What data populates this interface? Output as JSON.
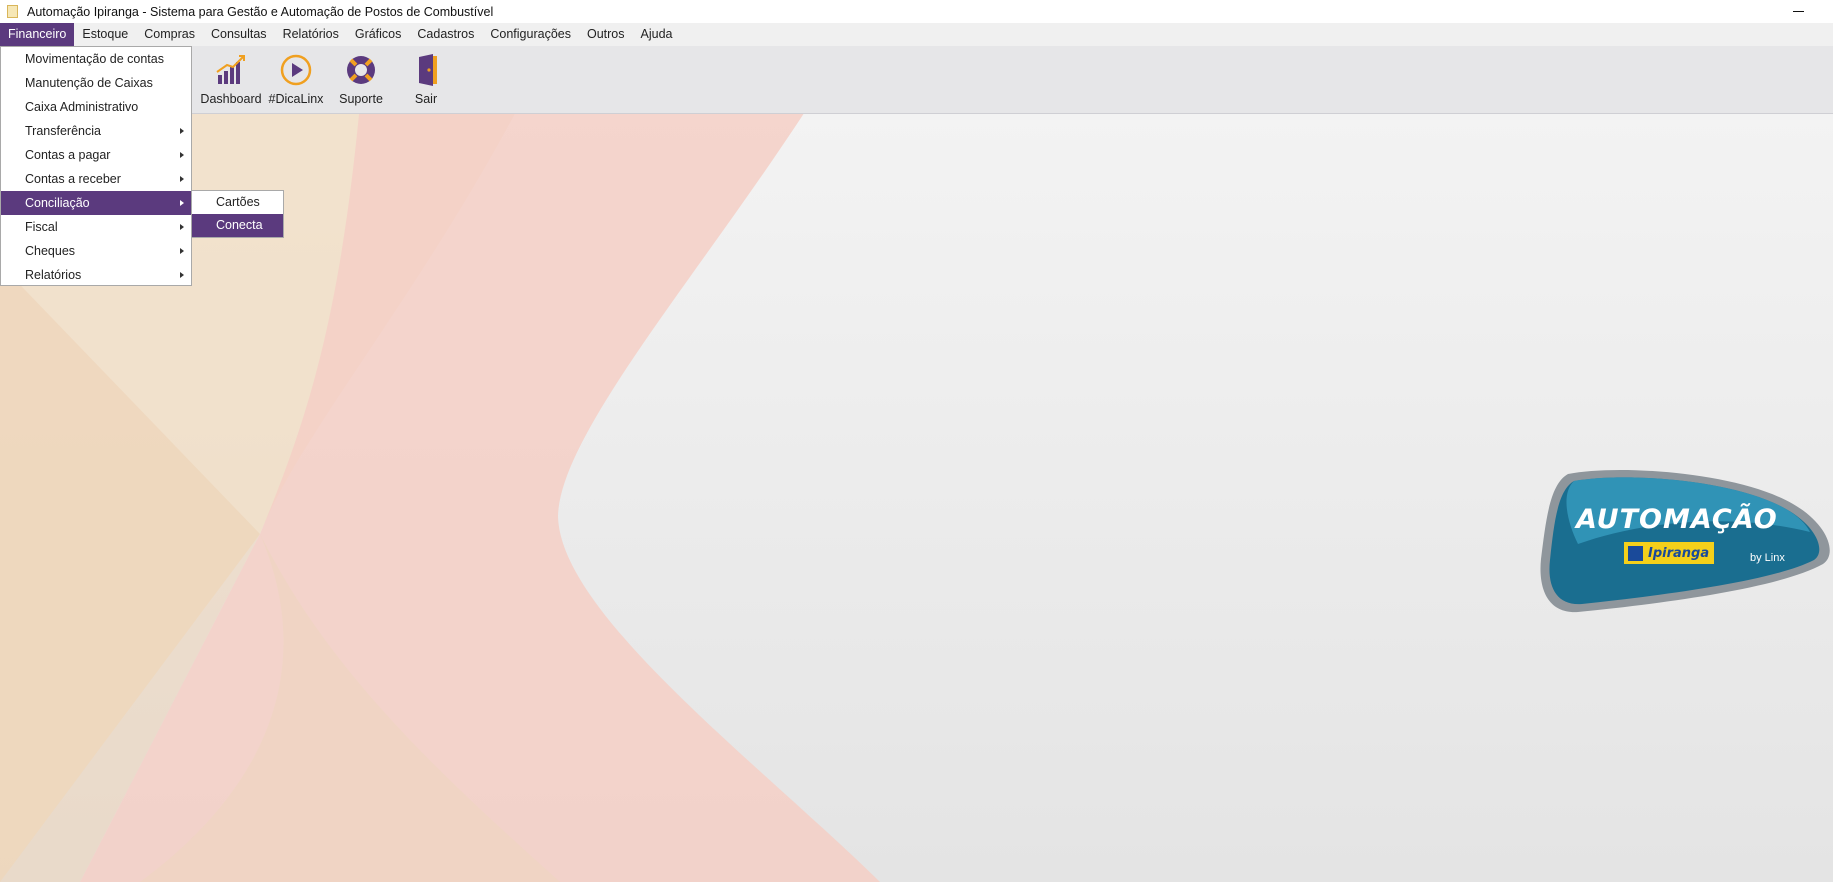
{
  "window": {
    "title": "Automação Ipiranga - Sistema para Gestão e Automação de Postos de Combustível"
  },
  "menubar": {
    "items": [
      {
        "label": "Financeiro",
        "active": true
      },
      {
        "label": "Estoque"
      },
      {
        "label": "Compras"
      },
      {
        "label": "Consultas"
      },
      {
        "label": "Relatórios"
      },
      {
        "label": "Gráficos"
      },
      {
        "label": "Cadastros"
      },
      {
        "label": "Configurações"
      },
      {
        "label": "Outros"
      },
      {
        "label": "Ajuda"
      }
    ]
  },
  "toolbar": {
    "buttons": [
      {
        "label": "Dashboard",
        "icon": "dashboard-chart-icon"
      },
      {
        "label": "#DicaLinx",
        "icon": "play-circle-icon"
      },
      {
        "label": "Suporte",
        "icon": "lifebuoy-icon"
      },
      {
        "label": "Sair",
        "icon": "exit-door-icon"
      }
    ]
  },
  "financeiro_menu": {
    "items": [
      {
        "label": "Movimentação de contas",
        "submenu": false
      },
      {
        "label": "Manutenção de Caixas",
        "submenu": false
      },
      {
        "label": "Caixa Administrativo",
        "submenu": false
      },
      {
        "label": "Transferência",
        "submenu": true
      },
      {
        "label": "Contas a pagar",
        "submenu": true
      },
      {
        "label": "Contas a receber",
        "submenu": true
      },
      {
        "label": "Conciliação",
        "submenu": true,
        "active": true
      },
      {
        "label": "Fiscal",
        "submenu": true
      },
      {
        "label": "Cheques",
        "submenu": true
      },
      {
        "label": "Relatórios",
        "submenu": true
      }
    ]
  },
  "conciliacao_submenu": {
    "items": [
      {
        "label": "Cartões"
      },
      {
        "label": "Conecta",
        "active": true
      }
    ]
  },
  "logo": {
    "brand_text": "AUTOMAÇÃO",
    "badge_text": "Ipiranga",
    "byline": "by Linx"
  },
  "colors": {
    "accent": "#5b3a7e",
    "icon_purple": "#5b3a7e",
    "icon_orange": "#f0a020"
  }
}
